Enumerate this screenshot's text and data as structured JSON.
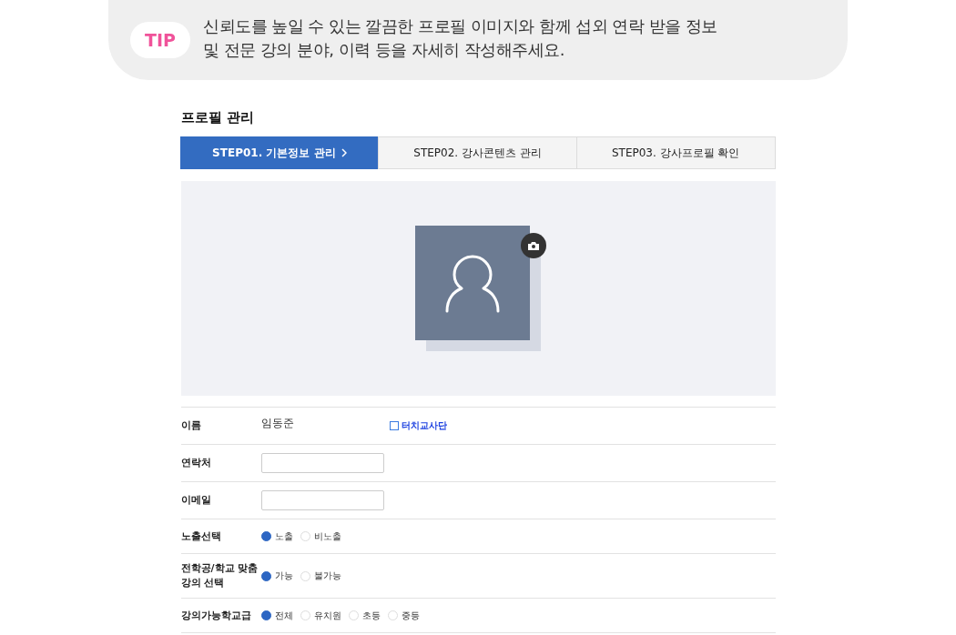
{
  "tip": {
    "badge": "TIP",
    "text": "신뢰도를 높일 수 있는 깔끔한 프로필 이미지와 함께 섭외 연락 받을 정보\n및 전문 강의 분야, 이력 등을 자세히 작성해주세요."
  },
  "title": "프로필 관리",
  "tabs": [
    {
      "label": "STEP01. 기본정보 관리",
      "selected": true
    },
    {
      "label": "STEP02. 강사콘텐츠 관리",
      "selected": false
    },
    {
      "label": "STEP03. 강사프로필 확인",
      "selected": false
    }
  ],
  "form": [
    {
      "kind": "text",
      "label": "이름",
      "value": "임동준",
      "checkbox": {
        "label": "터치교사단",
        "checked": false
      }
    },
    {
      "kind": "input",
      "label": "연락처"
    },
    {
      "kind": "input",
      "label": "이메일"
    },
    {
      "kind": "radio",
      "label": "노출선택",
      "options": [
        {
          "label": "노출",
          "selected": true
        },
        {
          "label": "비노출",
          "selected": false
        }
      ]
    },
    {
      "kind": "radio",
      "label": "전학공/학교 맞춤\n강의 선택",
      "options": [
        {
          "label": "가능",
          "selected": true
        },
        {
          "label": "불가능",
          "selected": false
        }
      ]
    },
    {
      "kind": "radio",
      "label": "강의가능학교급",
      "options": [
        {
          "label": "전체",
          "selected": true
        },
        {
          "label": "유치원",
          "selected": false
        },
        {
          "label": "초등",
          "selected": false
        },
        {
          "label": "중등",
          "selected": false
        }
      ]
    }
  ]
}
